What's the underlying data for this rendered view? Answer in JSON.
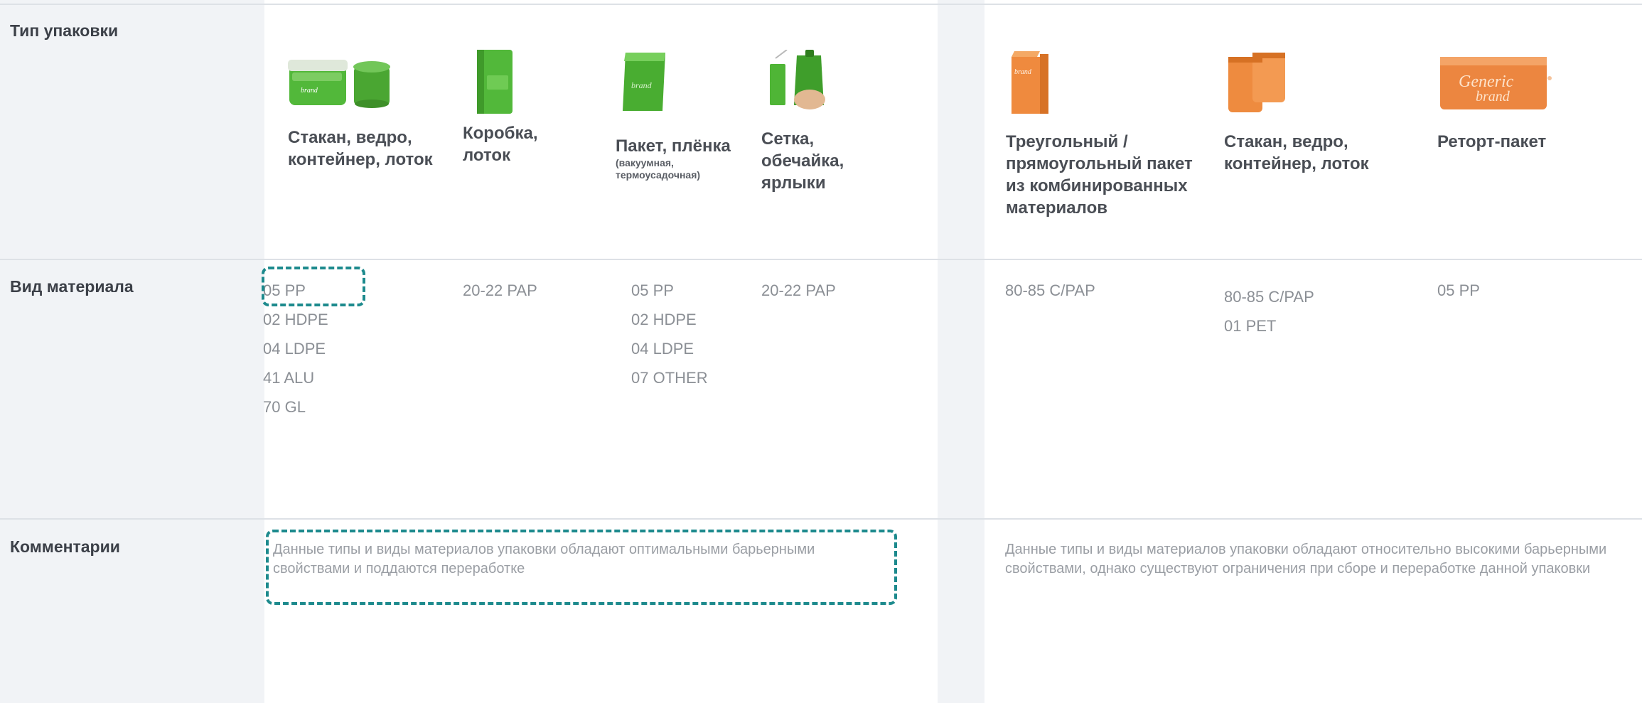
{
  "rows": {
    "type_label": "Тип упаковки",
    "material_label": "Вид материала",
    "comments_label": "Комментарии"
  },
  "colors": {
    "green": "#52b83a",
    "orange": "#ef8a3e",
    "accent_dash": "#1d8a8d"
  },
  "package_types": [
    {
      "name": "Стакан, ведро, контейнер, лоток",
      "icon": "tub-and-cup-green",
      "group": "green"
    },
    {
      "name": "Коробка, лоток",
      "icon": "box-green",
      "group": "green"
    },
    {
      "name": "Пакет, плёнка",
      "sub": "(вакуумная, термоусадочная)",
      "icon": "bag-green",
      "group": "green"
    },
    {
      "name": "Сетка, обечайка, ярлыки",
      "icon": "label-and-pouch-in-hand-green",
      "group": "green"
    },
    {
      "name": "Треугольный / прямоугольный пакет из комбинированных материалов",
      "icon": "carton-orange",
      "group": "orange"
    },
    {
      "name": "Стакан, ведро, контейнер, лоток",
      "icon": "pouches-orange",
      "group": "orange"
    },
    {
      "name": "Реторт-пакет",
      "icon": "retort-pouch-orange",
      "group": "orange"
    }
  ],
  "materials": [
    [
      "05 PP",
      "02 HDPE",
      "04 LDPE",
      "41 ALU",
      "70 GL"
    ],
    [
      "20-22 PAP"
    ],
    [
      "05 PP",
      "02 HDPE",
      "04 LDPE",
      "07 OTHER"
    ],
    [
      "20-22 PAP"
    ],
    [
      "80-85 C/PAP"
    ],
    [
      "80-85 C/PAP",
      "01 PET"
    ],
    [
      "05 PP"
    ]
  ],
  "comments": [
    "Данные типы и виды материалов упаковки обладают оптимальными барьерными свойствами и поддаются переработке",
    "Данные типы и виды материалов упаковки обладают относительно высокими барьерными свойствами, однако существуют ограничения при сборе и переработке данной упаковки"
  ]
}
